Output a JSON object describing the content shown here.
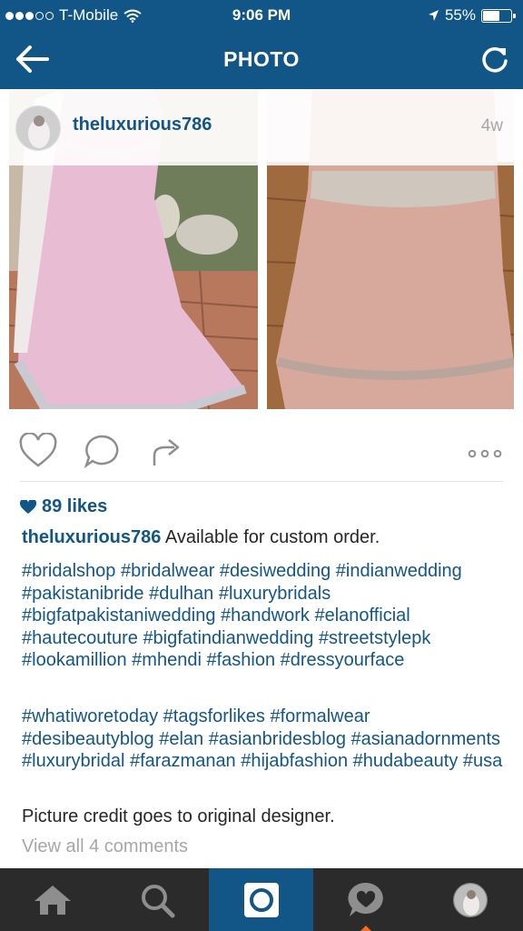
{
  "status_bar": {
    "carrier": "T-Mobile",
    "time": "9:06 PM",
    "battery": "55%",
    "battery_level": 0.55,
    "signal_bars_filled": 3,
    "signal_bars_total": 5
  },
  "nav": {
    "title": "PHOTO",
    "back_icon": "back-arrow-icon",
    "refresh_icon": "refresh-icon",
    "bar_color": "#125688"
  },
  "post": {
    "username": "theluxurious786",
    "age": "4w",
    "likes": "89 likes",
    "caption_text": "Available for custom order.",
    "hashtags_1": "#bridalshop #bridalwear #desiwedding #indianwedding #pakistanibride #dulhan #luxurybridals #bigfatpakistaniwedding #handwork #elanofficial #hautecouture #bigfatindianwedding #streetstylepk #lookamillion #mhendi #fashion #dressyourface",
    "hashtags_2": "#whatiworetoday #tagsforlikes #formalwear #desibeautyblog #elan #asianbridesblog #asianadornments #luxurybridal #farazmanan #hijabfashion #hudabeauty #usa",
    "credit": "Picture credit goes to original designer.",
    "view_comments": "View all 4 comments"
  },
  "actions": [
    "heart-icon",
    "comment-icon",
    "share-icon",
    "more-icon"
  ],
  "tabbar": {
    "tabs": [
      "home-icon",
      "search-icon",
      "camera-icon",
      "activity-icon",
      "profile-avatar"
    ],
    "active_index": 2,
    "accent": "#f26f22"
  }
}
